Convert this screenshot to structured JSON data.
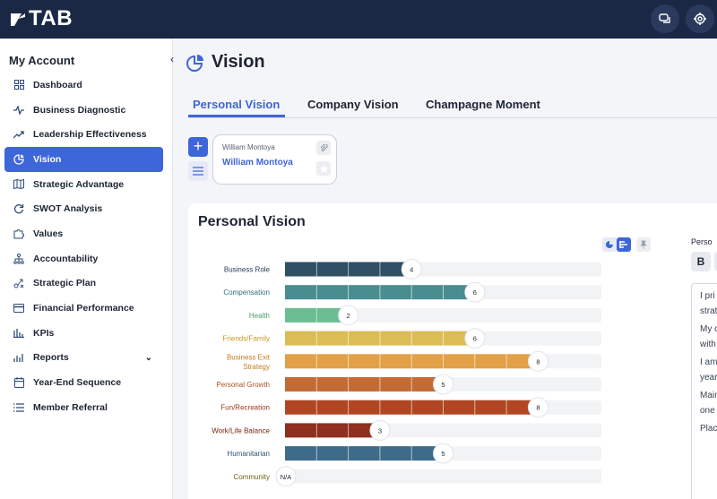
{
  "brand": {
    "logo_text": "TAB"
  },
  "header": {
    "icons": [
      "chat-icon",
      "support-icon"
    ]
  },
  "sidebar": {
    "title": "My Account",
    "items": [
      {
        "label": "Dashboard",
        "icon": "grid-icon"
      },
      {
        "label": "Business Diagnostic",
        "icon": "pulse-icon"
      },
      {
        "label": "Leadership Effectiveness",
        "icon": "trend-icon"
      },
      {
        "label": "Vision",
        "icon": "pie-icon",
        "active": true
      },
      {
        "label": "Strategic Advantage",
        "icon": "map-icon"
      },
      {
        "label": "SWOT Analysis",
        "icon": "refresh-icon"
      },
      {
        "label": "Values",
        "icon": "puzzle-icon"
      },
      {
        "label": "Accountability",
        "icon": "org-icon"
      },
      {
        "label": "Strategic Plan",
        "icon": "strategy-icon"
      },
      {
        "label": "Financial Performance",
        "icon": "card-icon"
      },
      {
        "label": "KPIs",
        "icon": "bars-icon"
      },
      {
        "label": "Reports",
        "icon": "report-icon"
      },
      {
        "label": "Year-End Sequence",
        "icon": "calendar-icon"
      },
      {
        "label": "Member Referral",
        "icon": "list-icon"
      }
    ]
  },
  "page": {
    "title": "Vision",
    "tabs": [
      {
        "label": "Personal Vision",
        "active": true
      },
      {
        "label": "Company Vision"
      },
      {
        "label": "Champagne Moment"
      }
    ]
  },
  "person_card": {
    "small_name": "William Montoya",
    "name": "William Montoya"
  },
  "panel": {
    "title": "Personal Vision",
    "side_label": "Perso",
    "bold_label": "B",
    "editor_lines": [
      "I pri",
      "strat",
      "My c",
      "with",
      "I am",
      "year",
      "Main",
      "one",
      "Plac"
    ]
  },
  "chart_data": {
    "type": "bar",
    "orientation": "horizontal",
    "xlim": [
      0,
      10
    ],
    "categories": [
      "Business Role",
      "Compensation",
      "Health",
      "Friends/Family",
      "Business Exit Strategy",
      "Personal Growth",
      "Fun/Recreation",
      "Work/Life Balance",
      "Humanitarian",
      "Community"
    ],
    "values": [
      4,
      6,
      2,
      6,
      8,
      5,
      8,
      3,
      5,
      null
    ],
    "data_labels": [
      "4",
      "6",
      "2",
      "6",
      "8",
      "5",
      "8",
      "3",
      "5",
      "N/A"
    ],
    "colors": [
      "#2f4f64",
      "#4a8d91",
      "#6bbd92",
      "#dcbd55",
      "#e2a048",
      "#c36b36",
      "#b24624",
      "#8e2f1f",
      "#3e6b8a",
      "#8a7a2a"
    ],
    "label_colors": [
      "#1d3a5a",
      "#2e6e73",
      "#4a9e6a",
      "#c69a20",
      "#c57a1c",
      "#a8531f",
      "#9a3516",
      "#7a2412",
      "#2e5678",
      "#6e6418"
    ]
  }
}
